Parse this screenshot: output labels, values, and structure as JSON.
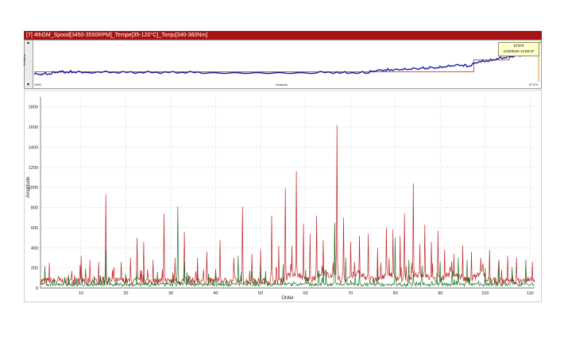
{
  "window": {
    "title": "[7] 4thGM_Spood[3450-3550RPM]_Tempe[35-120°C]_Torqu[340-360Nm]"
  },
  "overview": {
    "vertical_label": "% Alarm",
    "x_label": "Analysis",
    "x_start": "1000",
    "x_end": "67379",
    "tooltip_line1": "67379",
    "tooltip_line2": "1/19/2016 12:56:37",
    "scroll_up_icon": "triangle-up-icon",
    "scroll_down_icon": "triangle-down-icon",
    "trend": [
      [
        0.0,
        0.18
      ],
      [
        0.03,
        0.19
      ],
      [
        0.05,
        0.25
      ],
      [
        0.06,
        0.23
      ],
      [
        0.07,
        0.24
      ],
      [
        0.1,
        0.23
      ],
      [
        0.2,
        0.22
      ],
      [
        0.3,
        0.22
      ],
      [
        0.4,
        0.22
      ],
      [
        0.5,
        0.22
      ],
      [
        0.6,
        0.22
      ],
      [
        0.66,
        0.22
      ],
      [
        0.68,
        0.28
      ],
      [
        0.72,
        0.3
      ],
      [
        0.76,
        0.32
      ],
      [
        0.8,
        0.35
      ],
      [
        0.84,
        0.42
      ],
      [
        0.86,
        0.38
      ],
      [
        0.88,
        0.5
      ],
      [
        0.9,
        0.52
      ],
      [
        0.92,
        0.58
      ],
      [
        0.94,
        0.62
      ],
      [
        0.96,
        0.65
      ],
      [
        0.98,
        0.68
      ],
      [
        1.0,
        0.7
      ]
    ],
    "threshold": [
      [
        0.0,
        0.25
      ],
      [
        0.87,
        0.25
      ],
      [
        0.87,
        0.55
      ],
      [
        0.94,
        0.55
      ],
      [
        0.94,
        0.7
      ],
      [
        1.0,
        0.7
      ]
    ],
    "colors": {
      "trend": "#1a1aa6",
      "threshold": "#b22222"
    }
  },
  "chart_data": {
    "type": "line",
    "xlabel": "Order",
    "ylabel": "Amplitude",
    "xlim": [
      1,
      111
    ],
    "ylim": [
      0,
      1900
    ],
    "xticks": [
      10,
      20,
      30,
      40,
      50,
      60,
      70,
      80,
      90,
      100,
      110
    ],
    "yticks": [
      0,
      200,
      400,
      600,
      800,
      1000,
      1200,
      1400,
      1600,
      1800
    ],
    "grid": true,
    "series": [
      {
        "color": "#c0282c",
        "baseline": 70,
        "peaks": [
          [
            3,
            250
          ],
          [
            5,
            120
          ],
          [
            8,
            170
          ],
          [
            10,
            320
          ],
          [
            12,
            280
          ],
          [
            14,
            260
          ],
          [
            15.5,
            930
          ],
          [
            17,
            180
          ],
          [
            19,
            260
          ],
          [
            21,
            300
          ],
          [
            22.5,
            500
          ],
          [
            24,
            460
          ],
          [
            26,
            280
          ],
          [
            28.5,
            740
          ],
          [
            31,
            300
          ],
          [
            33,
            560
          ],
          [
            36,
            300
          ],
          [
            38,
            360
          ],
          [
            41,
            480
          ],
          [
            44,
            300
          ],
          [
            46,
            810
          ],
          [
            48,
            340
          ],
          [
            50,
            380
          ],
          [
            52.5,
            720
          ],
          [
            54,
            420
          ],
          [
            55.5,
            990
          ],
          [
            57,
            420
          ],
          [
            58,
            1160
          ],
          [
            59.5,
            640
          ],
          [
            61,
            540
          ],
          [
            62.5,
            720
          ],
          [
            64,
            480
          ],
          [
            66.5,
            640
          ],
          [
            67,
            1620
          ],
          [
            68.5,
            700
          ],
          [
            70,
            460
          ],
          [
            72,
            520
          ],
          [
            74,
            540
          ],
          [
            76,
            400
          ],
          [
            78,
            600
          ],
          [
            79.5,
            580
          ],
          [
            81,
            520
          ],
          [
            82,
            740
          ],
          [
            84,
            1040
          ],
          [
            85.5,
            440
          ],
          [
            86.5,
            630
          ],
          [
            88,
            460
          ],
          [
            89.5,
            570
          ],
          [
            91,
            380
          ],
          [
            93,
            340
          ],
          [
            95,
            420
          ],
          [
            97,
            360
          ],
          [
            99,
            300
          ],
          [
            101,
            380
          ],
          [
            103,
            280
          ],
          [
            105,
            320
          ],
          [
            107,
            300
          ],
          [
            109,
            280
          ],
          [
            110.5,
            260
          ]
        ]
      },
      {
        "color": "#1e7a2a",
        "baseline": 35,
        "peaks": [
          [
            2,
            220
          ],
          [
            4,
            90
          ],
          [
            9,
            100
          ],
          [
            13,
            120
          ],
          [
            15.5,
            380
          ],
          [
            20,
            140
          ],
          [
            24,
            130
          ],
          [
            27,
            160
          ],
          [
            31.5,
            810
          ],
          [
            33,
            260
          ],
          [
            36,
            140
          ],
          [
            40,
            180
          ],
          [
            45,
            320
          ],
          [
            50,
            210
          ],
          [
            55,
            240
          ],
          [
            60,
            180
          ],
          [
            64,
            200
          ],
          [
            66.5,
            650
          ],
          [
            69,
            300
          ],
          [
            72,
            180
          ],
          [
            76,
            200
          ],
          [
            80,
            500
          ],
          [
            83,
            280
          ],
          [
            86,
            220
          ],
          [
            90,
            260
          ],
          [
            94,
            300
          ],
          [
            96,
            280
          ],
          [
            100,
            200
          ],
          [
            103,
            240
          ],
          [
            106,
            210
          ],
          [
            109,
            220
          ]
        ]
      }
    ]
  }
}
